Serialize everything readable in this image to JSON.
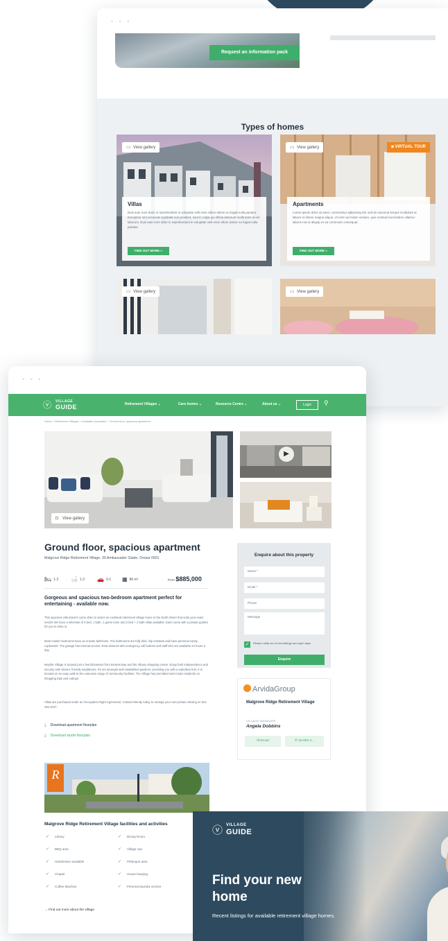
{
  "back_window": {
    "dots": "• • •",
    "info_button": "Request an information pack",
    "types_title": "Types of homes",
    "cards": [
      {
        "gallery_label": "View gallery",
        "title": "Villas",
        "text": "Duis aute irure dolor in reprehenderit in voluptate velit esse cillum dolore eu fugiat nulla pariatur. Excepteur sint occaecat cupidatat non proident, sunt in culpa qui officia deserunt mollit anim id est laborum. Duis aute irure dolor in reprehenderit in voluptate velit esse cillum dolore eu fugiat nulla pariatur.",
        "button": "FIND OUT MORE »"
      },
      {
        "gallery_label": "View gallery",
        "title": "Apartments",
        "virtual_tour": "VIRTUAL TOUR",
        "text": "Lorem ipsum dolor sit amet, consectetur adipiscing elit, sed do eiusmod tempor incididunt ut labore et dolore magna aliqua. Ut enim ad minim veniam, quis nostrud exercitation ullamco laboris nisi ut aliquip ex ea commodo consequat.",
        "button": "FIND OUT MORE »"
      },
      {
        "gallery_label": "View gallery"
      },
      {
        "gallery_label": "View gallery"
      }
    ]
  },
  "front_window": {
    "dots": "• • •",
    "logo": {
      "top": "VILLAGE",
      "bottom": "GUIDE"
    },
    "nav": [
      "Retirement Villages ⌄",
      "Care homes ⌄",
      "Resource Centre ⌄",
      "About us ⌄"
    ],
    "login": "Login",
    "breadcrumb": "Home  >  Retirement Villages  >  Available properties  >  Ground floor, spacious apartment",
    "view_gallery": "View gallery",
    "title": "Ground floor, spacious apartment",
    "address": "Malgrove Ridge Retirement Village, 30 Ambassador Glade, Orewa 0931",
    "features": [
      {
        "icon": "bed-icon",
        "glyph": "🛏",
        "value": "1-2"
      },
      {
        "icon": "bath-icon",
        "glyph": "🛁",
        "value": "1-2"
      },
      {
        "icon": "car-icon",
        "glyph": "🚗",
        "value": "0-1"
      },
      {
        "icon": "area-icon",
        "glyph": "▦",
        "value": "86 m²"
      }
    ],
    "price_prefix": "from",
    "price": "$885,000",
    "subheading": "Gorgeous and spacious two-bedroom apartment perfect for entertaining - available now.",
    "paragraphs": [
      "This spacious villa doesn't come often to select an Auckland retirement village home in the North Shore that suits your exact needs! We have a selection of 2 bed, 1 bath, 1 guest room and 2 bed + 2 bath villas available. Each come with a private garden for you to relax in.",
      "Most master bedrooms have an ensuite bathroom. The bathrooms are fully tiled, slip resistant and have personal vanity cupboards. The garage has internal access. Rest assured with emergency call buttons and staff who are available 24 hours a day.",
      "Meyfair Village is located just a few kilometres from Browns Bay and the Albany shopping centre. Enjoy both independence and security with vibrant, friendly neighbours. It's set amongst well established gardens, providing you with a suburban feel. It is located on an easy walk to the extensive range of community facilities. The Village has permitted select take residents on shopping trips and outings.",
      "Villas are purchased under an Occupation Right Agreement. Contact Wendy today to arrange your own private viewing on 022 294 2047."
    ],
    "downloads": [
      "Download apartment floorplan",
      "Download studio floorplan"
    ],
    "enquiry": {
      "title": "Enquire about this property",
      "fields": [
        "Name *",
        "Email *",
        "Phone",
        "Message"
      ],
      "checkbox": "Please notify me of new listings and open days",
      "button": "Enquire"
    },
    "agent": {
      "brand": "ArvidaGroup",
      "village": "Malgrove Ridge Retirement Village",
      "role": "VILLAGE MANAGER",
      "name": "Angela Dobbins",
      "email": "Email",
      "phone": "09 890 3..."
    },
    "facilities_title": "Malgrove Ridge Retirement Village facilities and activities",
    "facilities_left": [
      "Library",
      "BBQ area",
      "Hairdresser available",
      "Chapel",
      "Coffee Machine"
    ],
    "facilities_right": [
      "Dining Room",
      "Village van",
      "Pétanque area",
      "House keeping",
      "Personal laundry service"
    ],
    "more_link": "→  Find out more about the village"
  },
  "promo": {
    "logo": {
      "top": "VILLAGE",
      "bottom": "GUIDE"
    },
    "headline": "Find your new home",
    "sub": "Recent listings for available retirement village homes."
  },
  "colors": {
    "green": "#49b36d",
    "navy": "#2e4a5f",
    "orange": "#f0861e",
    "panel": "#eef1f3"
  }
}
